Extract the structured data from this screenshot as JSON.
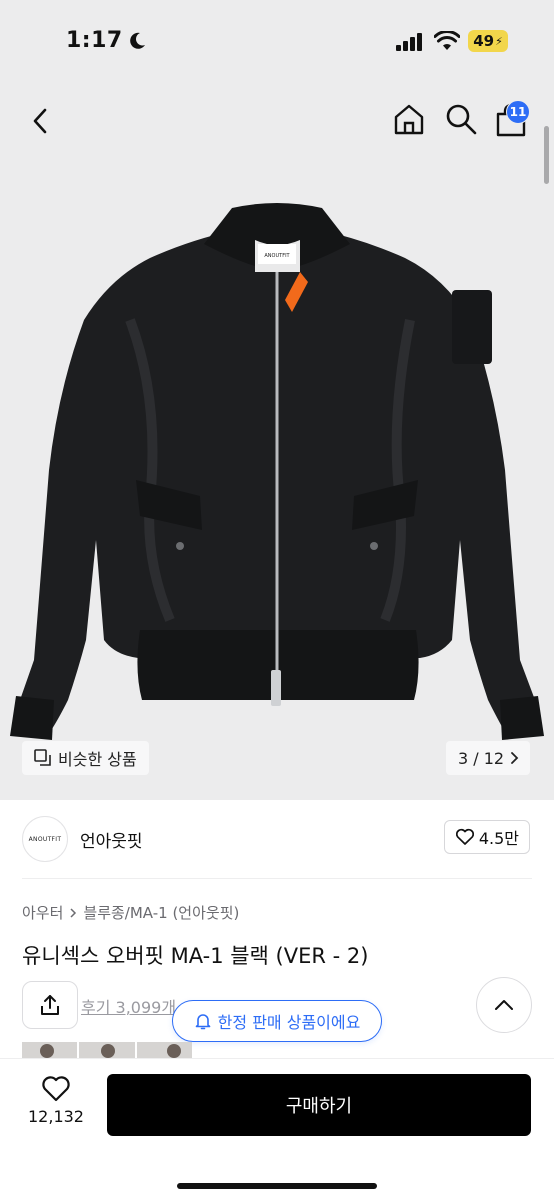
{
  "status": {
    "time": "1:17",
    "battery": "49"
  },
  "header": {
    "cart_count": "11"
  },
  "gallery": {
    "similar_label": "비슷한 상품",
    "page_indicator": "3 / 12",
    "jacket_tag": "ANOUTFIT"
  },
  "brand": {
    "logo_text": "ANOUTFIT",
    "name": "언아웃핏",
    "likes": "4.5만"
  },
  "product": {
    "breadcrumb": [
      "아우터",
      "블루종/MA-1 (언아웃핏)"
    ],
    "title": "유니섹스 오버핏 MA-1 블랙 (VER - 2)",
    "reviews": "후기 3,099개",
    "limited_badge": "한정 판매 상품이에요"
  },
  "bottom": {
    "wish_count": "12,132",
    "buy_label": "구매하기"
  },
  "colors": {
    "accent": "#2d6df6",
    "hero_bg": "#ececed",
    "jacket": "#1d1e20",
    "lining": "#f26a1b",
    "battery": "#f2d64b"
  },
  "icons": [
    "moon-icon",
    "signal-icon",
    "wifi-icon",
    "back-icon",
    "home-icon",
    "search-icon",
    "cart-icon",
    "similar-icon",
    "chevron-right-icon",
    "heart-icon",
    "share-icon",
    "bell-icon",
    "chevron-up-icon"
  ]
}
